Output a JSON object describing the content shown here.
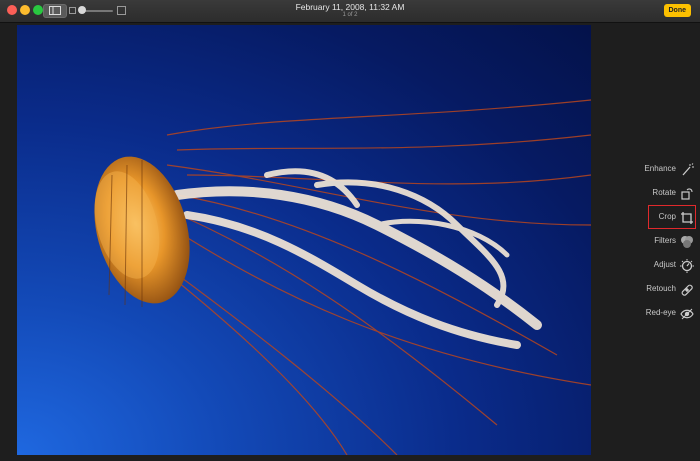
{
  "window": {
    "title": "February 11, 2008, 11:32 AM",
    "subtitle": "1 of 2",
    "done_label": "Done"
  },
  "toolbar": {
    "icons": [
      "sidebar-toggle-icon",
      "zoom-small-icon",
      "zoom-large-icon"
    ]
  },
  "edit_tools": [
    {
      "label": "Enhance",
      "icon": "magic-wand-icon"
    },
    {
      "label": "Rotate",
      "icon": "rotate-icon"
    },
    {
      "label": "Crop",
      "icon": "crop-icon"
    },
    {
      "label": "Filters",
      "icon": "filters-icon"
    },
    {
      "label": "Adjust",
      "icon": "adjust-dial-icon"
    },
    {
      "label": "Retouch",
      "icon": "bandage-icon"
    },
    {
      "label": "Red-eye",
      "icon": "eye-icon"
    }
  ],
  "selected_tool": "Crop",
  "colors": {
    "done_button": "#fcc000",
    "highlight": "#e0292c",
    "photo_background": "#0a2b8a",
    "jellyfish": "#e08a20"
  }
}
